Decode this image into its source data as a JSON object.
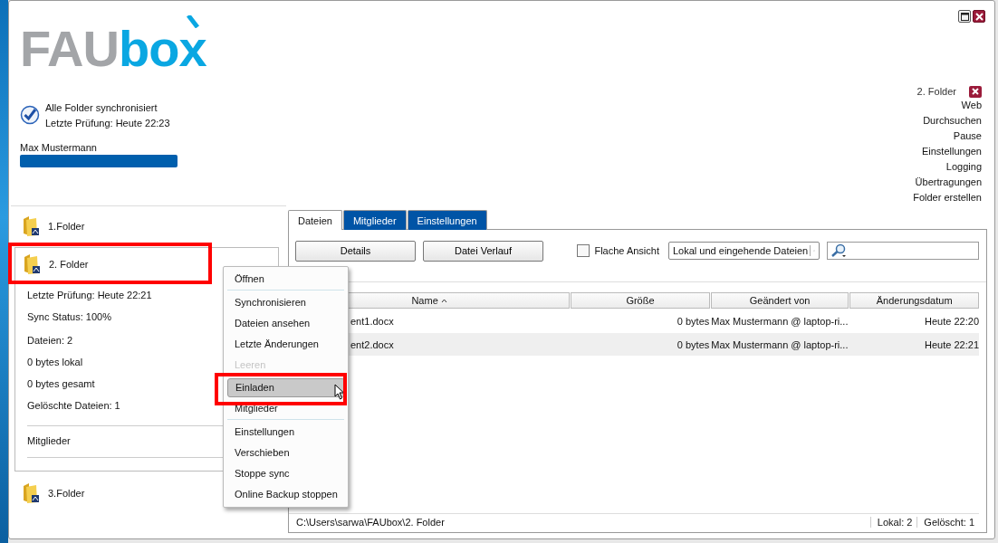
{
  "logo": {
    "dark": "FAU",
    "light": "box"
  },
  "status": {
    "synced": true,
    "title": "Alle Folder synchronisiert",
    "last_check": "Letzte Prüfung: Heute 22:23"
  },
  "user": {
    "name": "Max Mustermann",
    "level": 1
  },
  "actions": {
    "current_folder": "2. Folder",
    "links": [
      "Web",
      "Durchsuchen",
      "Pause",
      "Einstellungen",
      "Logging",
      "Übertragungen",
      "Folder erstellen"
    ]
  },
  "folders": [
    {
      "name": "1.Folder",
      "expanded": false,
      "annotated": false
    },
    {
      "name": "2. Folder",
      "expanded": true,
      "annotated": true,
      "details": [
        "Letzte Prüfung: Heute 22:21",
        "Sync Status: 100%",
        "Dateien: 2",
        "0 bytes lokal",
        "0 bytes gesamt",
        "Gelöschte Dateien: 1"
      ],
      "members_label": "Mitglieder"
    },
    {
      "name": "3.Folder",
      "expanded": false,
      "annotated": false
    }
  ],
  "tabs": [
    {
      "label": "Dateien",
      "selected": true
    },
    {
      "label": "Mitglieder",
      "selected": false
    },
    {
      "label": "Einstellungen",
      "selected": false
    }
  ],
  "toolbar": {
    "buttons": [
      "Details",
      "Datei Verlauf"
    ],
    "flat_view": {
      "label": "Flache Ansicht",
      "checked": false
    },
    "filter": {
      "value": "Lokal und eingehende Dateien"
    }
  },
  "table": {
    "columns": [
      {
        "label": "Name",
        "sorted": true
      },
      {
        "label": "Größe",
        "sorted": false
      },
      {
        "label": "Geändert von",
        "sorted": false
      },
      {
        "label": "Änderungsdatum",
        "sorted": false
      }
    ],
    "rows": [
      {
        "cells": [
          "ent1.docx",
          "0 bytes",
          "Max Mustermann @ laptop-ri...",
          "Heute 22:20"
        ]
      },
      {
        "cells": [
          "ent2.docx",
          "0 bytes",
          "Max Mustermann @ laptop-ri...",
          "Heute 22:21"
        ]
      }
    ]
  },
  "status_bar": {
    "path": "C:\\Users\\sarwa\\FAUbox\\2. Folder",
    "counts": [
      "Lokal: 2",
      "Gelöscht: 1"
    ]
  },
  "context_menu": {
    "items": [
      {
        "label": "Öffnen",
        "disabled": false,
        "hovered": false,
        "annotated": false,
        "separator_after": true
      },
      {
        "label": "Synchronisieren",
        "disabled": false,
        "hovered": false,
        "annotated": false,
        "separator_after": false
      },
      {
        "label": "Dateien ansehen",
        "disabled": false,
        "hovered": false,
        "annotated": false,
        "separator_after": false
      },
      {
        "label": "Letzte Änderungen",
        "disabled": false,
        "hovered": false,
        "annotated": false,
        "separator_after": false
      },
      {
        "label": "Leeren",
        "disabled": true,
        "hovered": false,
        "annotated": false,
        "separator_after": true
      },
      {
        "label": "Einladen",
        "disabled": false,
        "hovered": true,
        "annotated": true,
        "separator_after": false
      },
      {
        "label": "Mitglieder",
        "disabled": false,
        "hovered": false,
        "annotated": false,
        "separator_after": true
      },
      {
        "label": "Einstellungen",
        "disabled": false,
        "hovered": false,
        "annotated": false,
        "separator_after": false
      },
      {
        "label": "Verschieben",
        "disabled": false,
        "hovered": false,
        "annotated": false,
        "separator_after": false
      },
      {
        "label": "Stoppe sync",
        "disabled": false,
        "hovered": false,
        "annotated": false,
        "separator_after": false
      },
      {
        "label": "Online Backup stoppen",
        "disabled": false,
        "hovered": false,
        "annotated": false,
        "separator_after": false
      }
    ]
  }
}
